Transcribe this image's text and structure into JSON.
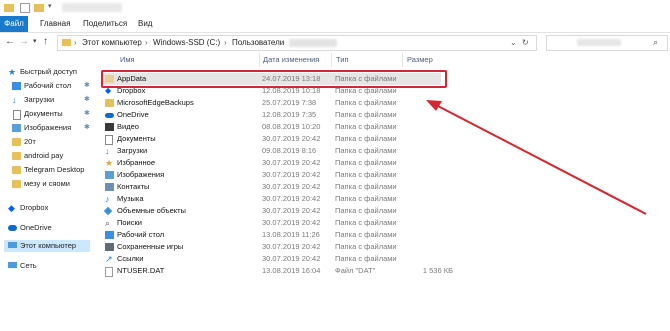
{
  "ribbon": {
    "tabs": [
      "Файл",
      "Главная",
      "Поделиться",
      "Вид"
    ]
  },
  "address": {
    "crumbs": [
      "Этот компьютер",
      "Windows-SSD (C:)",
      "Пользователи"
    ]
  },
  "columns": {
    "name": "Имя",
    "date": "Дата изменения",
    "type": "Тип",
    "size": "Размер"
  },
  "sidebar": {
    "items": [
      {
        "label": "Быстрый доступ",
        "icon": "star-icon"
      },
      {
        "label": "Рабочий стол",
        "icon": "desktop-icon",
        "pinned": true
      },
      {
        "label": "Загрузки",
        "icon": "download-icon",
        "pinned": true
      },
      {
        "label": "Документы",
        "icon": "documents-icon",
        "pinned": true
      },
      {
        "label": "Изображения",
        "icon": "pictures-icon",
        "pinned": true
      },
      {
        "label": "20т",
        "icon": "folder-icon"
      },
      {
        "label": "android pay",
        "icon": "folder-icon"
      },
      {
        "label": "Telegram Desktop",
        "icon": "folder-icon"
      },
      {
        "label": "мезу и сяоми",
        "icon": "folder-icon"
      },
      {
        "label": "Dropbox",
        "icon": "dropbox-icon"
      },
      {
        "label": "OneDrive",
        "icon": "onedrive-icon"
      },
      {
        "label": "Этот компьютер",
        "icon": "computer-icon",
        "selected": true
      },
      {
        "label": "Сеть",
        "icon": "network-icon"
      }
    ]
  },
  "files": [
    {
      "name": "AppData",
      "date": "24.07.2019 13:18",
      "type": "Папка с файлами",
      "size": "",
      "icon": "folder-icon",
      "selected": true
    },
    {
      "name": "Dropbox",
      "date": "12.08.2019 10:18",
      "type": "Папка с файлами",
      "size": "",
      "icon": "dropbox-icon"
    },
    {
      "name": "MicrosoftEdgeBackups",
      "date": "25.07.2019 7:38",
      "type": "Папка с файлами",
      "size": "",
      "icon": "folder-icon"
    },
    {
      "name": "OneDrive",
      "date": "12.08.2019 7:35",
      "type": "Папка с файлами",
      "size": "",
      "icon": "onedrive-icon"
    },
    {
      "name": "Видео",
      "date": "08.08.2019 10:20",
      "type": "Папка с файлами",
      "size": "",
      "icon": "video-icon"
    },
    {
      "name": "Документы",
      "date": "30.07.2019 20:42",
      "type": "Папка с файлами",
      "size": "",
      "icon": "documents-icon"
    },
    {
      "name": "Загрузки",
      "date": "09.08.2019 8:16",
      "type": "Папка с файлами",
      "size": "",
      "icon": "download-icon"
    },
    {
      "name": "Избранное",
      "date": "30.07.2019 20:42",
      "type": "Папка с файлами",
      "size": "",
      "icon": "favorites-icon"
    },
    {
      "name": "Изображения",
      "date": "30.07.2019 20:42",
      "type": "Папка с файлами",
      "size": "",
      "icon": "pictures-icon"
    },
    {
      "name": "Контакты",
      "date": "30.07.2019 20:42",
      "type": "Папка с файлами",
      "size": "",
      "icon": "contacts-icon"
    },
    {
      "name": "Музыка",
      "date": "30.07.2019 20:42",
      "type": "Папка с файлами",
      "size": "",
      "icon": "music-icon"
    },
    {
      "name": "Объемные объекты",
      "date": "30.07.2019 20:42",
      "type": "Папка с файлами",
      "size": "",
      "icon": "3d-objects-icon"
    },
    {
      "name": "Поиски",
      "date": "30.07.2019 20:42",
      "type": "Папка с файлами",
      "size": "",
      "icon": "search-folder-icon"
    },
    {
      "name": "Рабочий стол",
      "date": "13.08.2019 11:26",
      "type": "Папка с файлами",
      "size": "",
      "icon": "desktop-icon"
    },
    {
      "name": "Сохраненные игры",
      "date": "30.07.2019 20:42",
      "type": "Папка с файлами",
      "size": "",
      "icon": "saved-games-icon"
    },
    {
      "name": "Ссылки",
      "date": "30.07.2019 20:42",
      "type": "Папка с файлами",
      "size": "",
      "icon": "links-icon"
    },
    {
      "name": "NTUSER.DAT",
      "date": "13.08.2019 16:04",
      "type": "Файл \"DAT\"",
      "size": "1 536 КБ",
      "icon": "file-icon"
    }
  ],
  "colors": {
    "accent": "#1979ca",
    "highlight": "#d7262d",
    "selected": "#cce8ff",
    "folder": "#e8c05a"
  }
}
